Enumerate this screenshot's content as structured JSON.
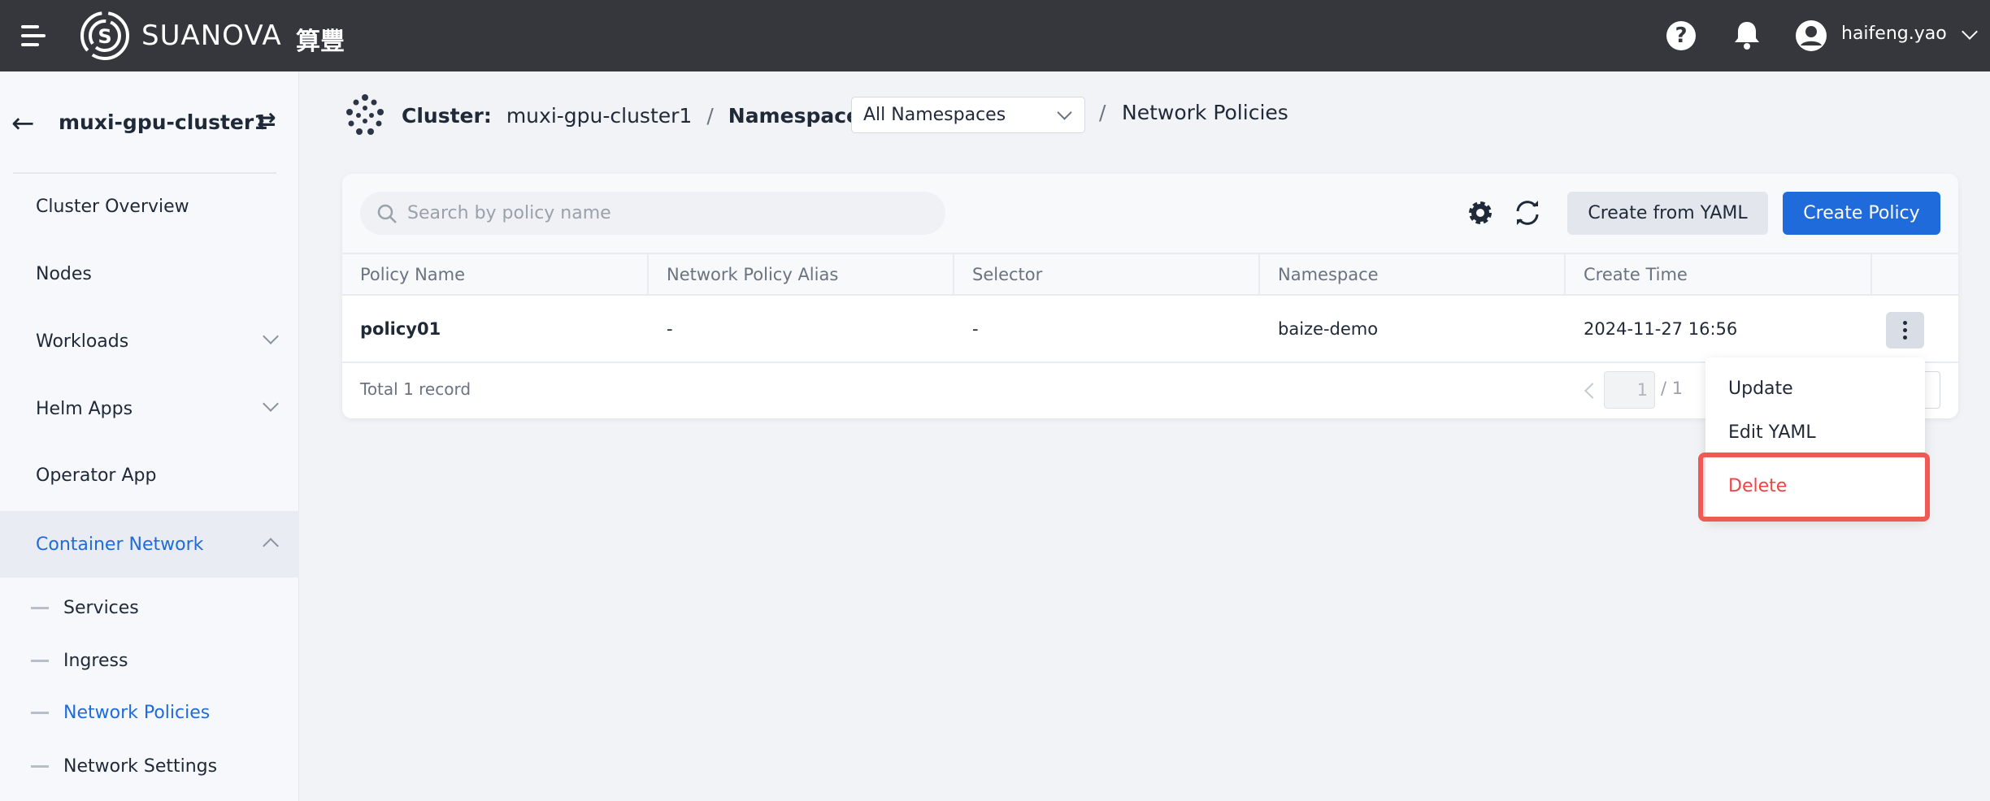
{
  "header": {
    "brand": "SUANOVA",
    "brand_cn": "算豐",
    "user": "haifeng.yao",
    "icons": [
      "menu-icon",
      "help-icon",
      "bell-icon",
      "avatar-icon",
      "chevron-down-icon"
    ]
  },
  "sidebar": {
    "cluster": "muxi-gpu-cluster1",
    "items": [
      {
        "label": "Cluster Overview"
      },
      {
        "label": "Nodes"
      },
      {
        "label": "Workloads"
      },
      {
        "label": "Helm Apps"
      },
      {
        "label": "Operator App"
      },
      {
        "label": "Container Network"
      }
    ],
    "subitems": [
      {
        "label": "Services"
      },
      {
        "label": "Ingress"
      },
      {
        "label": "Network Policies"
      },
      {
        "label": "Network Settings"
      }
    ]
  },
  "breadcrumb": {
    "cluster_label": "Cluster:",
    "cluster": "muxi-gpu-cluster1",
    "namespace_label": "Namespace:",
    "namespace": "All Namespaces",
    "page": "Network Policies",
    "sep": "/"
  },
  "toolbar": {
    "search_placeholder": "Search by policy name",
    "create_yaml": "Create from YAML",
    "create_policy": "Create Policy"
  },
  "table": {
    "columns": [
      "Policy Name",
      "Network Policy Alias",
      "Selector",
      "Namespace",
      "Create Time"
    ],
    "rows": [
      [
        "policy01",
        "-",
        "-",
        "baize-demo",
        "2024-11-27 16:56"
      ]
    ],
    "total": "Total 1 record",
    "page": "1",
    "pages": "/ 1"
  },
  "menu": {
    "items": [
      "Update",
      "Edit YAML",
      "Delete"
    ]
  },
  "colors": {
    "accent": "#1f6bdc",
    "danger": "#ef4444",
    "highlight": "#ef5a54",
    "topbar": "#35373d"
  }
}
